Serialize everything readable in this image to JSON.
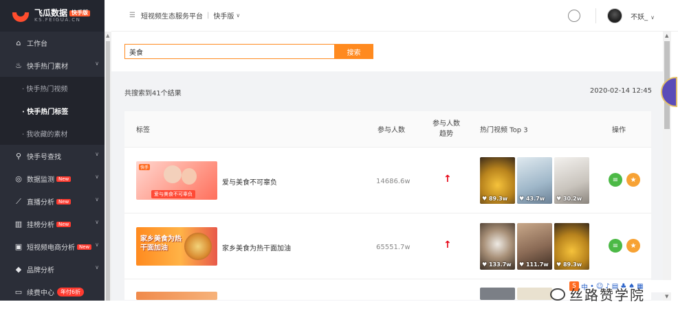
{
  "brand": {
    "title": "飞瓜数据",
    "badge": "快手版",
    "sub": "KS.FEIGUA.CN",
    "accent": "#ff8a1f"
  },
  "sidebar": {
    "items": [
      {
        "label": "工作台",
        "icon": "home-icon"
      },
      {
        "label": "快手热门素材",
        "icon": "fire-icon",
        "expanded": true
      },
      {
        "label": "快手号查找",
        "icon": "search-icon"
      },
      {
        "label": "数据监测",
        "icon": "monitor-icon",
        "badge": "New"
      },
      {
        "label": "直播分析",
        "icon": "live-icon",
        "badge": "New"
      },
      {
        "label": "挂榜分析",
        "icon": "bar-icon",
        "badge": "New"
      },
      {
        "label": "短视频电商分析",
        "icon": "shop-icon",
        "badge": "New"
      },
      {
        "label": "品牌分析",
        "icon": "diamond-icon"
      },
      {
        "label": "续费中心",
        "icon": "card-icon",
        "pill": "年付6折"
      }
    ],
    "subitems": [
      {
        "label": "· 快手热门视频",
        "active": false
      },
      {
        "label": "· 快手热门标签",
        "active": true
      },
      {
        "label": "· 我收藏的素材",
        "active": false
      }
    ]
  },
  "header": {
    "platform": "短视频生态服务平台",
    "separator": "|",
    "version": "快手版",
    "user": "不妖_"
  },
  "search": {
    "value": "美食",
    "button": "搜索"
  },
  "results": {
    "count_text": "共搜索到41个结果",
    "date": "2020-02-14 12:45"
  },
  "table": {
    "headers": {
      "tag": "标签",
      "participants": "参与人数",
      "trend": "参与人数趋势",
      "top_videos": "热门视频 Top 3",
      "ops": "操作"
    },
    "rows": [
      {
        "tag": "爱与美食不可辜负",
        "thumb_caption": "爱与美食不可辜负",
        "count": "14686.6w",
        "trend": "↑",
        "videos": [
          {
            "likes": "89.3w",
            "color": "#d9a634"
          },
          {
            "likes": "43.7w",
            "color": "#9fb7c9"
          },
          {
            "likes": "30.2w",
            "color": "#c9c4bd"
          }
        ]
      },
      {
        "tag": "家乡美食为热干面加油",
        "thumb_caption": "家乡美食为热干面加油",
        "count": "65551.7w",
        "trend": "↑",
        "videos": [
          {
            "likes": "133.7w",
            "color": "#6b5a48"
          },
          {
            "likes": "111.7w",
            "color": "#8a6a55"
          },
          {
            "likes": "89.3w",
            "color": "#d9a634"
          }
        ]
      }
    ]
  },
  "watermark": "丝路赞学院"
}
